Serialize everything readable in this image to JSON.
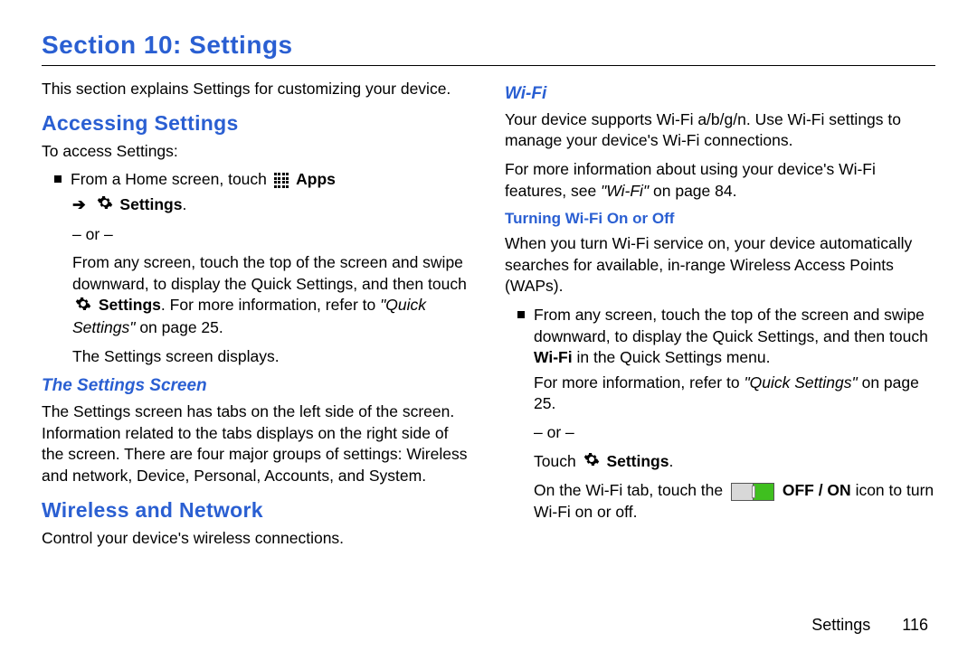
{
  "title": "Section 10: Settings",
  "intro": "This section explains Settings for customizing your device.",
  "h_access": "Accessing Settings",
  "access_lead": "To access Settings:",
  "step1_pre": "From a Home screen, touch ",
  "apps_label": "Apps",
  "arrow": "➔",
  "settings_label": "Settings",
  "period": ".",
  "or": "– or –",
  "step1_alt_a": "From any screen, touch the top of the screen and swipe downward, to display the Quick Settings, and then touch ",
  "settings_label2": "Settings",
  "step1_alt_b": ". For more information, refer to ",
  "quick_settings_ref": "\"Quick Settings\"",
  "on_page25": " on page 25.",
  "settings_displays": "The Settings screen displays.",
  "h_settings_screen": "The Settings Screen",
  "settings_screen_body": "The Settings screen has tabs on the left side of the screen. Information related to the tabs displays on the right side of the screen. There are four major groups of settings: Wireless and network, Device, Personal, Accounts, and System.",
  "h_wireless": "Wireless and Network",
  "wireless_body": "Control your device's wireless connections.",
  "h_wifi": "Wi-Fi",
  "wifi_p1": "Your device supports Wi-Fi a/b/g/n. Use Wi-Fi settings to manage your device's Wi-Fi connections.",
  "wifi_p2a": "For more information about using your device's Wi-Fi features, see ",
  "wifi_p2_ref": "\"Wi-Fi\"",
  "wifi_p2b": " on page 84.",
  "h_wifi_toggle": "Turning Wi-Fi On or Off",
  "wifi_toggle_body": "When you turn Wi-Fi service on, your device automatically searches for available, in-range Wireless Access Points (WAPs).",
  "wifi_step_a": "From any screen, touch the top of the screen and swipe downward, to display the Quick Settings, and then touch ",
  "wifi_bold": "Wi-Fi",
  "wifi_step_b": " in the Quick Settings menu.",
  "wifi_more_a": "For more information, refer to ",
  "wifi_more_ref": "\"Quick Settings\"",
  "wifi_more_b": " on page 25.",
  "touch_word": "Touch ",
  "settings_label3": "Settings",
  "toggle_sentence_a": "On the Wi-Fi tab, touch the ",
  "offon": "OFF / ON",
  "toggle_sentence_b": " icon to turn Wi-Fi on or off.",
  "footer_label": "Settings",
  "footer_page": "116"
}
